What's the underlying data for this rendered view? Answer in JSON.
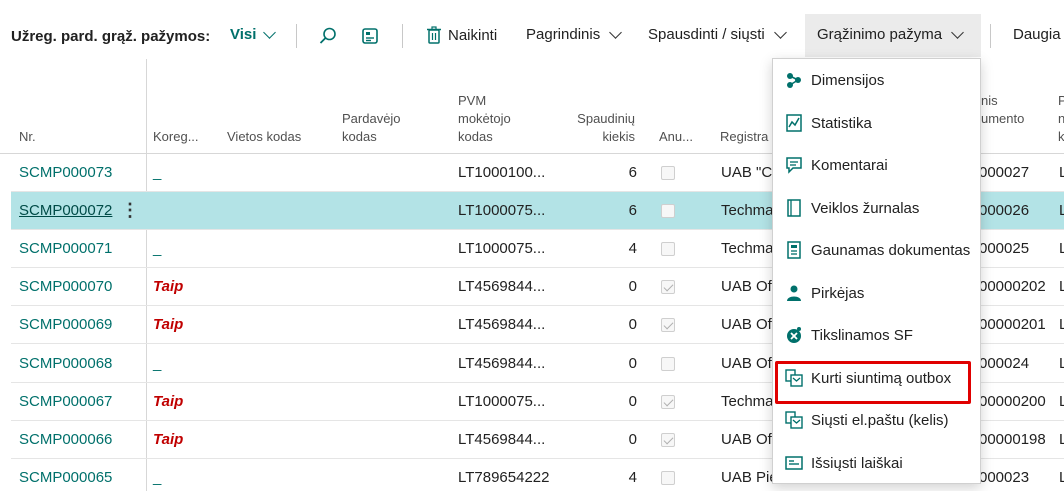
{
  "toolbar": {
    "caption": "Užreg. pard. grąž. pažymos:",
    "view_filter": "Visi",
    "delete_label": "Naikinti",
    "home_label": "Pagrindinis",
    "print_label": "Spausdinti / siųsti",
    "return_label": "Grąžinimo pažyma",
    "more_label": "Daugia"
  },
  "columns": {
    "nr": "Nr.",
    "koreg": "Koreg...",
    "vietos": "Vietos kodas",
    "pardavejo_1": "Pardavėjo",
    "pardavejo_2": "kodas",
    "pvm_1": "PVM",
    "pvm_2": "mokėtojo",
    "pvm_3": "kodas",
    "spaud_1": "Spaudinių",
    "spaud_2": "kiekis",
    "anul": "Anu...",
    "registr": "Registra",
    "dok_1": "nis",
    "dok_2": "umento",
    "last_1": "P",
    "last_2": "n",
    "last_3": "k"
  },
  "rows": [
    {
      "nr": "SCMP000073",
      "koreg": "_",
      "pvm": "LT1000100...",
      "qty": "6",
      "anul": false,
      "reg": "UAB \"C",
      "dok": "000027",
      "last": "L"
    },
    {
      "nr": "SCMP000072",
      "koreg": "",
      "pvm": "LT1000075...",
      "qty": "6",
      "anul": false,
      "reg": "Techma",
      "dok": "000026",
      "last": "L"
    },
    {
      "nr": "SCMP000071",
      "koreg": "_",
      "pvm": "LT1000075...",
      "qty": "4",
      "anul": false,
      "reg": "Techma",
      "dok": "000025",
      "last": "L"
    },
    {
      "nr": "SCMP000070",
      "koreg": "Taip",
      "pvm": "LT4569844...",
      "qty": "0",
      "anul": true,
      "reg": "UAB Of",
      "dok": "00000202",
      "last": "L"
    },
    {
      "nr": "SCMP000069",
      "koreg": "Taip",
      "pvm": "LT4569844...",
      "qty": "0",
      "anul": true,
      "reg": "UAB Of",
      "dok": "00000201",
      "last": "L"
    },
    {
      "nr": "SCMP000068",
      "koreg": "_",
      "pvm": "LT4569844...",
      "qty": "0",
      "anul": false,
      "reg": "UAB Of",
      "dok": "000024",
      "last": "L"
    },
    {
      "nr": "SCMP000067",
      "koreg": "Taip",
      "pvm": "LT1000075...",
      "qty": "0",
      "anul": true,
      "reg": "Techma",
      "dok": "00000200",
      "last": "L"
    },
    {
      "nr": "SCMP000066",
      "koreg": "Taip",
      "pvm": "LT4569844...",
      "qty": "0",
      "anul": true,
      "reg": "UAB Of",
      "dok": "00000198",
      "last": "L"
    },
    {
      "nr": "SCMP000065",
      "koreg": "_",
      "pvm": "LT789654222",
      "qty": "4",
      "anul": false,
      "reg": "UAB Pie",
      "dok": "000023",
      "last": "L"
    }
  ],
  "menu": {
    "items": [
      {
        "label": "Dimensijos",
        "icon": "dimensions-icon"
      },
      {
        "label": "Statistika",
        "icon": "statistics-icon"
      },
      {
        "label": "Komentarai",
        "icon": "comment-icon"
      },
      {
        "label": "Veiklos žurnalas",
        "icon": "log-icon"
      },
      {
        "label": "Gaunamas dokumentas",
        "icon": "incoming-document-icon"
      },
      {
        "label": "Pirkėjas",
        "icon": "customer-icon"
      },
      {
        "label": "Tikslinamos SF",
        "icon": "correction-invoice-icon"
      },
      {
        "label": "Kurti siuntimą outbox",
        "icon": "outbox-icon"
      },
      {
        "label": "Siųsti el.paštu (kelis)",
        "icon": "email-multiple-icon"
      },
      {
        "label": "Išsiųsti laiškai",
        "icon": "sent-mail-icon"
      }
    ]
  },
  "colors": {
    "accent": "#00706b",
    "selected_row": "#b3e3e6",
    "alert": "#c00000",
    "highlight_border": "#e00000"
  }
}
